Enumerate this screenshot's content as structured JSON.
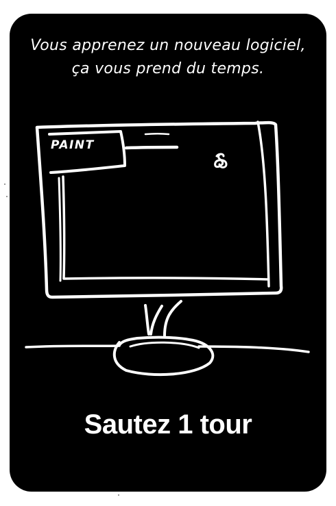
{
  "card": {
    "caption_line1": "Vous apprenez un nouveau logiciel,",
    "caption_line2": "ça vous prend du temps.",
    "screen_label": "PAINT",
    "action_label": "Sautez 1 tour"
  },
  "colors": {
    "card_background": "#000000",
    "ink": "#ffffff",
    "page_background": "#ffffff"
  },
  "icons": {
    "cursor": "hourglass-doodle-icon"
  }
}
